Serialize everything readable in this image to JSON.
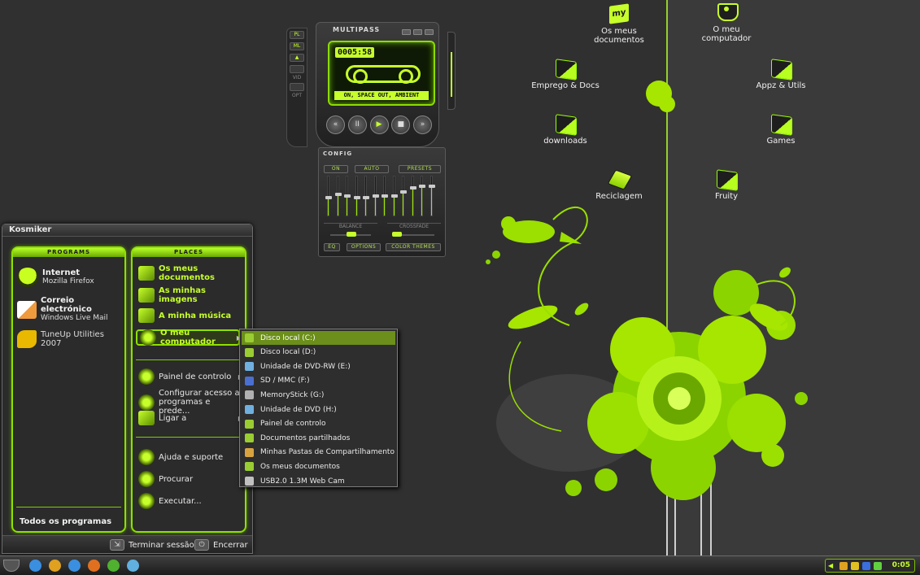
{
  "desktop": {
    "icons": [
      {
        "label": "Os meus documentos",
        "icon": "my-documents-icon"
      },
      {
        "label": "O meu computador",
        "icon": "my-computer-icon"
      },
      {
        "label": "Emprego & Docs",
        "icon": "folder-icon"
      },
      {
        "label": "Appz & Utils",
        "icon": "folder-icon"
      },
      {
        "label": "downloads",
        "icon": "folder-icon"
      },
      {
        "label": "Games",
        "icon": "folder-icon"
      },
      {
        "label": "Reciclagem",
        "icon": "recycle-bin-icon"
      },
      {
        "label": "Fruity",
        "icon": "folder-icon"
      }
    ]
  },
  "player": {
    "title": "MULTIPASS",
    "side_buttons": [
      "PL",
      "ML"
    ],
    "side_labels": [
      "VID",
      "OPT"
    ],
    "time": "0005:58",
    "song": "ON, SPACE OUT, AMBIENT",
    "transport": [
      "«",
      "II",
      "▶",
      "■",
      "»"
    ]
  },
  "equalizer": {
    "title": "CONFIG",
    "on_label": "ON",
    "auto_label": "AUTO",
    "presets_label": "PRESETS",
    "balance_label": "BALANCE",
    "crossfade_label": "CROSSFADE",
    "eq_label": "EQ",
    "options_label": "OPTIONS",
    "color_themes_label": "COLOR THEMES",
    "bands": [
      0.45,
      0.55,
      0.5,
      0.45,
      0.45,
      0.5,
      0.5,
      0.5,
      0.6,
      0.7,
      0.75,
      0.75
    ]
  },
  "start_menu": {
    "user": "Kosmiker",
    "programs_header": "PROGRAMS",
    "places_header": "PLACES",
    "programs": [
      {
        "title": "Internet",
        "subtitle": "Mozilla Firefox",
        "icon": "firefox-icon"
      },
      {
        "title": "Correio electrónico",
        "subtitle": "Windows Live Mail",
        "icon": "mail-icon"
      },
      {
        "title": "TuneUp Utilities 2007",
        "subtitle": "",
        "icon": "tuneup-icon"
      }
    ],
    "all_programs": "Todos os programas",
    "places": [
      {
        "label": "Os meus documentos",
        "icon": "my-documents-icon"
      },
      {
        "label": "As minhas imagens",
        "icon": "my-pictures-icon"
      },
      {
        "label": "A minha música",
        "icon": "my-music-icon"
      },
      {
        "label": "O meu computador",
        "icon": "my-computer-icon"
      }
    ],
    "system": [
      {
        "label": "Painel de controlo",
        "icon": "control-panel-icon"
      },
      {
        "label": "Configurar acesso a programas e prede...",
        "icon": "program-access-icon"
      },
      {
        "label": "Ligar a",
        "icon": "connect-to-icon"
      }
    ],
    "help": [
      {
        "label": "Ajuda e suporte",
        "icon": "help-icon"
      },
      {
        "label": "Procurar",
        "icon": "search-icon"
      },
      {
        "label": "Executar...",
        "icon": "run-icon"
      }
    ],
    "logoff_label": "Terminar sessão",
    "shutdown_label": "Encerrar"
  },
  "computer_submenu": [
    {
      "label": "Disco local (C:)",
      "icon": "drive-icon",
      "color": "#9acd32"
    },
    {
      "label": "Disco local (D:)",
      "icon": "drive-icon",
      "color": "#9acd32"
    },
    {
      "label": "Unidade de DVD-RW (E:)",
      "icon": "dvd-icon",
      "color": "#6fb0e0"
    },
    {
      "label": "SD / MMC (F:)",
      "icon": "card-icon",
      "color": "#4a6fd0"
    },
    {
      "label": "MemoryStick (G:)",
      "icon": "memorystick-icon",
      "color": "#b0b0b0"
    },
    {
      "label": "Unidade de DVD (H:)",
      "icon": "dvd-icon",
      "color": "#6fb0e0"
    },
    {
      "label": "Painel de controlo",
      "icon": "control-panel-icon",
      "color": "#9acd32"
    },
    {
      "label": "Documentos partilhados",
      "icon": "folder-icon",
      "color": "#9acd32"
    },
    {
      "label": "Minhas Pastas de Compartilhamento",
      "icon": "shared-folders-icon",
      "color": "#d9a440"
    },
    {
      "label": "Os meus documentos",
      "icon": "folder-icon",
      "color": "#9acd32"
    },
    {
      "label": "USB2.0 1.3M Web Cam",
      "icon": "webcam-icon",
      "color": "#c0c0c0"
    }
  ],
  "taskbar": {
    "quick_launch": [
      {
        "icon": "ie-icon",
        "color": "#3b8fe0"
      },
      {
        "icon": "winamp-icon",
        "color": "#e0a020"
      },
      {
        "icon": "ie-icon",
        "color": "#3b8fe0"
      },
      {
        "icon": "firefox-icon",
        "color": "#e07020"
      },
      {
        "icon": "utorrent-icon",
        "color": "#50b030"
      },
      {
        "icon": "messenger-icon",
        "color": "#60b0e0"
      }
    ],
    "tray_icons": [
      {
        "icon": "winamp-tray-icon",
        "color": "#e0a020"
      },
      {
        "icon": "tuneup-tray-icon",
        "color": "#e0c020"
      },
      {
        "icon": "security-tray-icon",
        "color": "#3b6fe0"
      },
      {
        "icon": "wireless-tray-icon",
        "color": "#60d040"
      }
    ],
    "clock": "0:05"
  },
  "colors": {
    "accent": "#c6ff2a",
    "background": "#2f2f2f"
  }
}
